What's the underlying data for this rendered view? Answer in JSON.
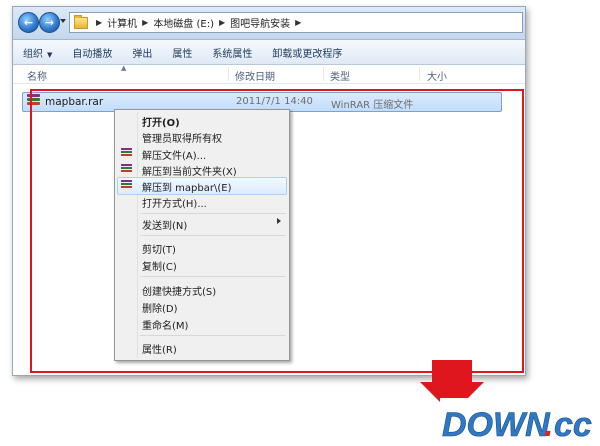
{
  "address": {
    "crumbs": [
      "计算机",
      "本地磁盘 (E:)",
      "图吧导航安装"
    ]
  },
  "toolbar": {
    "organize": "组织",
    "autoplay": "自动播放",
    "eject": "弹出",
    "properties": "属性",
    "system_properties": "系统属性",
    "uninstall": "卸载或更改程序"
  },
  "columns": {
    "name": "名称",
    "modified": "修改日期",
    "type": "类型",
    "size": "大小"
  },
  "file": {
    "name": "mapbar.rar",
    "modified": "2011/7/1 14:40",
    "type": "WinRAR 压缩文件"
  },
  "context_menu": {
    "open": "打开(O)",
    "take_ownership": "管理员取得所有权",
    "extract_files": "解压文件(A)...",
    "extract_here": "解压到当前文件夹(X)",
    "extract_to": "解压到 mapbar\\(E)",
    "open_with": "打开方式(H)...",
    "send_to": "发送到(N)",
    "cut": "剪切(T)",
    "copy": "复制(C)",
    "create_shortcut": "创建快捷方式(S)",
    "delete": "删除(D)",
    "rename": "重命名(M)",
    "properties": "属性(R)"
  },
  "logo": {
    "text_main": "DOWN",
    "text_dot": ".",
    "text_cc": "cc"
  },
  "colors": {
    "highlight_red": "#e0161e",
    "logo_blue": "#2f78c4",
    "logo_red": "#e22020"
  }
}
